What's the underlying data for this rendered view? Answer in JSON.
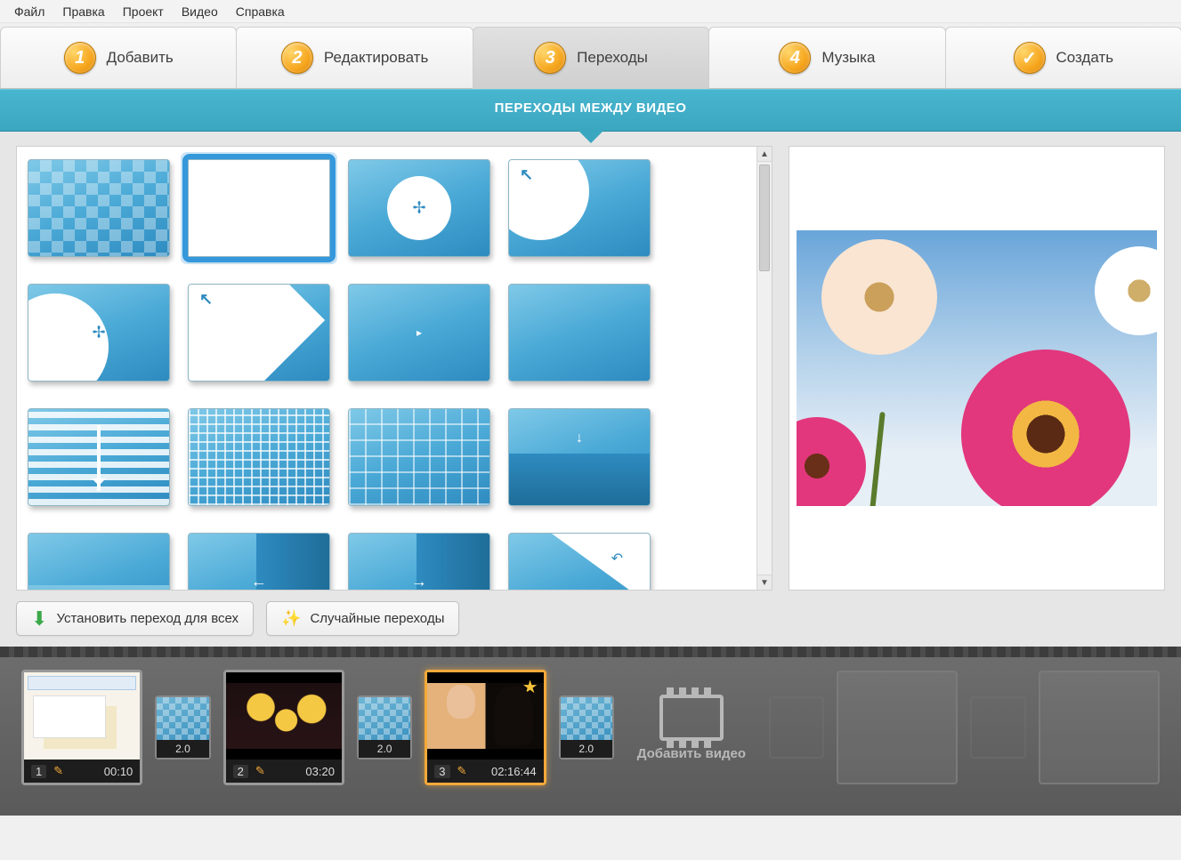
{
  "menu": {
    "items": [
      "Файл",
      "Правка",
      "Проект",
      "Видео",
      "Справка"
    ]
  },
  "steps": {
    "items": [
      {
        "num": "1",
        "label": "Добавить"
      },
      {
        "num": "2",
        "label": "Редактировать"
      },
      {
        "num": "3",
        "label": "Переходы"
      },
      {
        "num": "4",
        "label": "Музыка"
      },
      {
        "num": "✓",
        "label": "Создать"
      }
    ],
    "active_index": 2
  },
  "banner": {
    "title": "ПЕРЕХОДЫ МЕЖДУ ВИДЕО"
  },
  "transitions": {
    "selected_index": 1,
    "items": [
      "fade-checker-light",
      "checker-random",
      "circle-expand-center",
      "circle-expand-tl",
      "circle-expand-left",
      "diagonal-wipe-tl",
      "dot-arrow-center",
      "plain-fade",
      "hstripes-down",
      "grid-fine",
      "grid-large",
      "slide-half-down",
      "slide-half-bottom",
      "half-right-arrow-left",
      "half-right-arrow-right",
      "page-curl-tr"
    ]
  },
  "actions": {
    "apply_all": "Установить переход для всех",
    "random": "Случайные переходы"
  },
  "timeline": {
    "default_transition_duration": "2.0",
    "add_video_label": "Добавить видео",
    "selected_clip_index": 2,
    "clips": [
      {
        "index": "1",
        "duration": "00:10",
        "thumb": "ui-screenshot",
        "starred": false
      },
      {
        "index": "2",
        "duration": "03:20",
        "thumb": "minions-movie",
        "starred": false
      },
      {
        "index": "3",
        "duration": "02:16:44",
        "thumb": "actor-scene",
        "starred": true
      }
    ],
    "transitions_between": [
      "2.0",
      "2.0",
      "2.0"
    ]
  }
}
